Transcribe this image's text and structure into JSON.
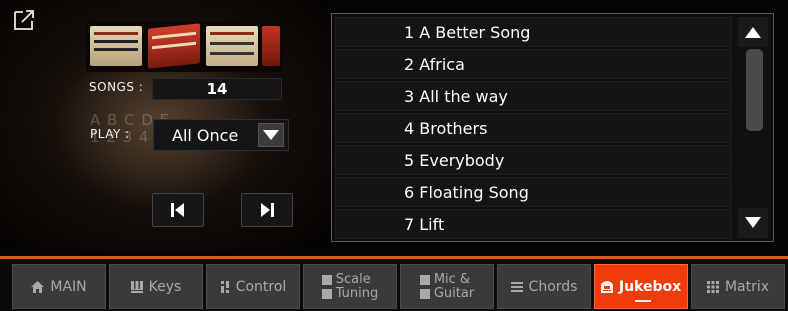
{
  "player": {
    "songs_label": "SONGS :",
    "songs_count": "14",
    "play_label": "PLAY :",
    "play_mode": "All Once",
    "background_letters": [
      "A B C D E",
      "1 2 3 4 5 6 7"
    ]
  },
  "songs": [
    "1 A Better Song",
    "2 Africa",
    "3 All the way",
    "4 Brothers",
    "5 Everybody",
    "6 Floating Song",
    "7 Lift"
  ],
  "icons": {
    "expand": "expand-icon",
    "previous": "skip-previous-icon",
    "next": "skip-next-icon",
    "scroll_up": "triangle-up-icon",
    "scroll_down": "triangle-down-icon",
    "dropdown": "triangle-down-icon"
  },
  "nav": {
    "tabs": [
      {
        "label": "MAIN",
        "icon": "home-icon"
      },
      {
        "label": "Keys",
        "icon": "keys-icon"
      },
      {
        "label": "Control",
        "icon": "control-icon"
      },
      {
        "label": "Scale",
        "label2": "Tuning",
        "icon": "scale-icon",
        "icon2": "tuning-icon"
      },
      {
        "label": "Mic &",
        "label2": "Guitar",
        "icon": "mic-icon",
        "icon2": "guitar-icon"
      },
      {
        "label": "Chords",
        "icon": "chords-icon"
      },
      {
        "label": "Jukebox",
        "icon": "jukebox-icon",
        "active": true
      },
      {
        "label": "Matrix",
        "icon": "matrix-icon"
      }
    ]
  },
  "colors": {
    "accent": "#e0561c",
    "active_tab": "#f03c0c",
    "tab_bg": "#3a3a3a",
    "tab_text": "#a9a9a9"
  }
}
